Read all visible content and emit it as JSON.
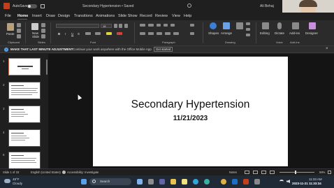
{
  "titlebar": {
    "autosave": "AutoSave",
    "doc_title": "Secondary Hypertension • Saved",
    "user": "Ali Behaj"
  },
  "menu": [
    "File",
    "Home",
    "Insert",
    "Draw",
    "Design",
    "Transitions",
    "Animations",
    "Slide Show",
    "Record",
    "Review",
    "View",
    "Help"
  ],
  "ribbon": {
    "paste": "Paste",
    "new_slide": "New\nSlide",
    "font_size": "18",
    "shapes": "Shapes",
    "arrange": "Arrange",
    "editing": "Editing",
    "dictate": "Dictate",
    "add_ins": "Add-ins",
    "designer": "Designer",
    "groups": [
      "Clipboard",
      "Slides",
      "Font",
      "Paragraph",
      "Drawing",
      "Voice",
      "Add-ins"
    ]
  },
  "message_bar": {
    "title": "MAKE THAT LAST MINUTE ADJUSTMENT",
    "text": "Continue your work anywhere with the Office Mobile App",
    "button": "Get started"
  },
  "thumbnails": [
    "1",
    "2",
    "3",
    "4",
    "5"
  ],
  "slide": {
    "title": "Secondary Hypertension",
    "subtitle": "11/21/2023"
  },
  "status": {
    "slide_count": "Slide 1 of 33",
    "language": "English (United States)",
    "accessibility": "Accessibility: Investigate",
    "notes": "Notes",
    "zoom": "59%"
  },
  "taskbar": {
    "weather_temp": "49°F",
    "weather_desc": "Cloudy",
    "search": "Search",
    "time": "11:33 AM",
    "date": "11/21/2023",
    "watermark": "2023-11-21 11:33:34"
  },
  "colors": {
    "accent": "#c43e1c",
    "slide_bg": "#ffffff"
  }
}
